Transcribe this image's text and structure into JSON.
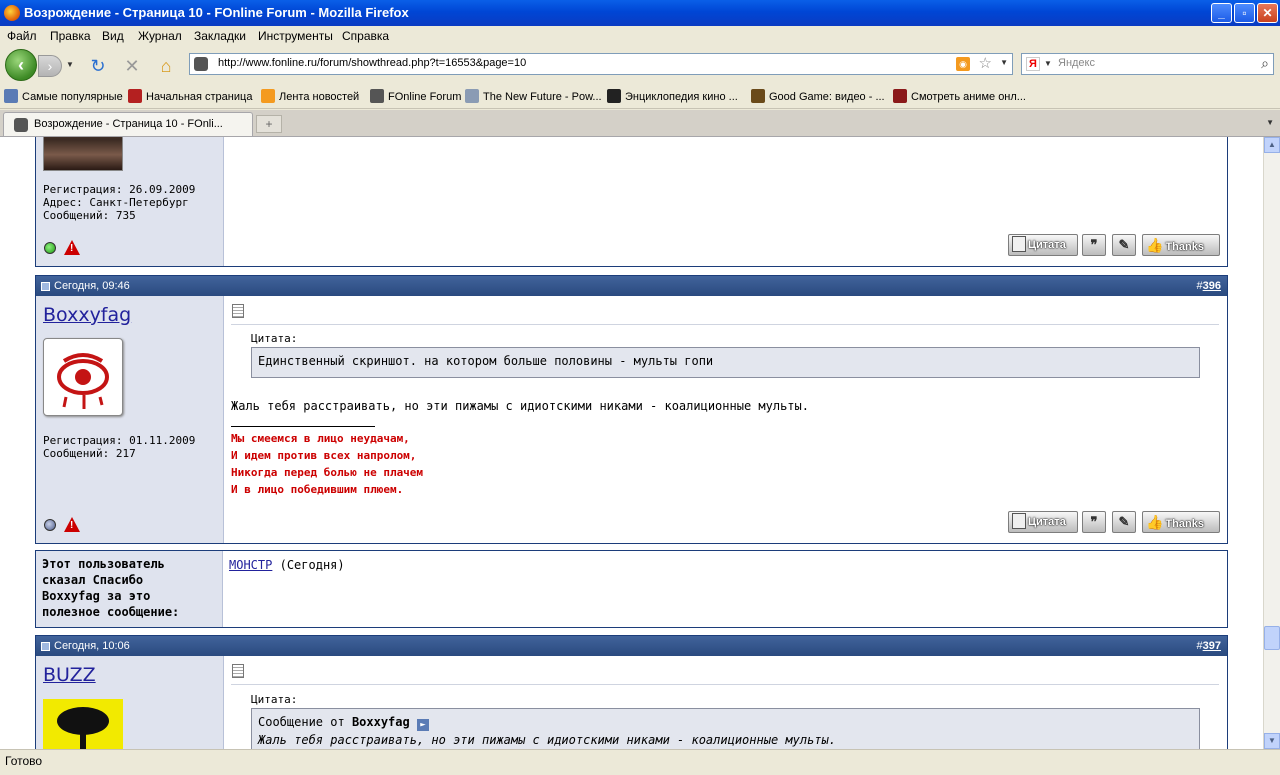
{
  "window": {
    "title": "Возрождение - Страница 10 - FOnline Forum - Mozilla Firefox"
  },
  "menu": [
    "Файл",
    "Правка",
    "Вид",
    "Журнал",
    "Закладки",
    "Инструменты",
    "Справка"
  ],
  "nav": {
    "url": "http://www.fonline.ru/forum/showthread.php?t=16553&page=10",
    "search_placeholder": "Яндекс",
    "search_engine_letter": "Я"
  },
  "bookmarks": [
    "Самые популярные",
    "Начальная страница",
    "Лента новостей",
    "FOnline Forum",
    "The New Future - Pow...",
    "Энциклопедия кино ...",
    "Good Game: видео - ...",
    "Смотреть аниме онл..."
  ],
  "tabs": [
    {
      "title": "Возрождение - Страница 10 - FOnli..."
    }
  ],
  "tab_new_symbol": "+",
  "status": "Готово",
  "buttons": {
    "quote": "Цитата",
    "thanks": "Thanks"
  },
  "posts": [
    {
      "registration": "Регистрация: 26.09.2009",
      "address": "Адрес: Санкт-Петербург",
      "messages": "Сообщений: 735",
      "online": true
    },
    {
      "date": "Сегодня, 09:46",
      "number_hash": "#",
      "number": "396",
      "username": "Boxxyfag",
      "registration": "Регистрация: 01.11.2009",
      "messages": "Сообщений: 217",
      "quote_label": "Цитата:",
      "quote_text": "Единственный скриншот. на котором больше половины - мульты гопи",
      "text": "Жаль тебя расстраивать, но эти пижамы с идиотскими никами - коалиционные мульты.",
      "signature": [
        "Мы смеемся в лицо неудачам,",
        "И идем против всех напролом,",
        "Никогда перед болью не плачем",
        "И в лицо победившим плюем."
      ],
      "online": false
    },
    {
      "date": "Сегодня, 10:06",
      "number_hash": "#",
      "number": "397",
      "username": "BUZZ",
      "quote_label": "Цитата:",
      "quote_from_prefix": "Сообщение от",
      "quote_from_user": "Boxxyfag",
      "quote_text": "Жаль тебя расстраивать, но эти пижамы с идиотскими никами - коалиционные мульты."
    }
  ],
  "thanks_block": {
    "label_lines": [
      "Этот пользователь",
      "сказал Спасибо",
      "Boxxyfag за это",
      "полезное сообщение:"
    ],
    "user": "МОНСТР",
    "when": "(Сегодня)"
  },
  "colors": {
    "post_header": "#2a4a7f",
    "user_bg": "#dfe3ee",
    "signature": "#cc0000",
    "link": "#22229c"
  }
}
